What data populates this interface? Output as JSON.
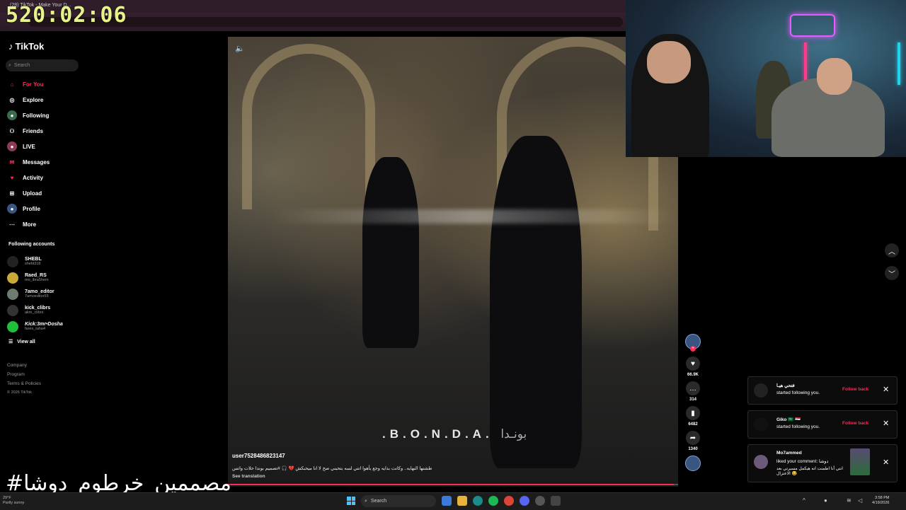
{
  "browser": {
    "tab_title": "(28) TikTok - Make Your D...",
    "timer": "520:02:06"
  },
  "sidebar": {
    "brand": "TikTok",
    "search_placeholder": "Search",
    "nav": [
      {
        "label": "For You",
        "icon": "home-icon"
      },
      {
        "label": "Explore",
        "icon": "compass-icon"
      },
      {
        "label": "Following",
        "icon": "following-icon"
      },
      {
        "label": "Friends",
        "icon": "friends-icon"
      },
      {
        "label": "LIVE",
        "icon": "live-icon"
      },
      {
        "label": "Messages",
        "icon": "messages-icon"
      },
      {
        "label": "Activity",
        "icon": "activity-icon"
      },
      {
        "label": "Upload",
        "icon": "upload-icon"
      },
      {
        "label": "Profile",
        "icon": "profile-icon"
      },
      {
        "label": "More",
        "icon": "more-icon"
      }
    ],
    "following_title": "Following accounts",
    "accounts": [
      {
        "name": "SHEBL",
        "handle": "shebl318"
      },
      {
        "name": "Raed_RS",
        "handle": "mo_ibra5hem"
      },
      {
        "name": "7amo_editor",
        "handle": "7amoeditor55"
      },
      {
        "name": "kick_clibrs",
        "handle": "akm_clibrs"
      },
      {
        "name": "Kick:3mr•Dosha",
        "handle": "fares_taha4"
      }
    ],
    "view_all": "View all",
    "footer": [
      "Company",
      "Program",
      "Terms & Policies"
    ],
    "copyright": "© 2026 TikTok"
  },
  "video": {
    "watermark": ".B.O.N.D.A.",
    "watermark_ar": "بونـدا",
    "username": "user7528486823147",
    "caption": "طشنها النهايه.. وكانت بدايه وجع يأهوا انتي لسه بتحبني صح لا انا ميحبكش 💔 🎧 #تصميم بوندا حلات واتس",
    "see_translation": "See translation",
    "progress": 0.99,
    "likes": "66.9K",
    "comments": "314",
    "bookmarks": "6482",
    "shares": "1340"
  },
  "notifications": [
    {
      "title": "فتحي هيـا",
      "body": "started following you.",
      "action": "Follow back"
    },
    {
      "title": "Giko 🇸🇦 🇪🇬",
      "body": "started following you.",
      "action": "Follow back"
    },
    {
      "title": "Mo7ammed",
      "body": "liked your comment: دوشا",
      "body2": "انتي أنا اطمنت انه هيكمل مسيرتي بعد الاعتزال 😂"
    }
  ],
  "overlay": {
    "hashtag": "#مصممين_خرطوم_دوشا"
  },
  "taskbar": {
    "weather_temp": "29°F",
    "weather_desc": "Partly sunny",
    "search": "Search",
    "time": "3:58 PM",
    "date": "4/19/2026"
  },
  "colors": {
    "accent": "#fe2c55",
    "timer": "#e7f28a"
  }
}
